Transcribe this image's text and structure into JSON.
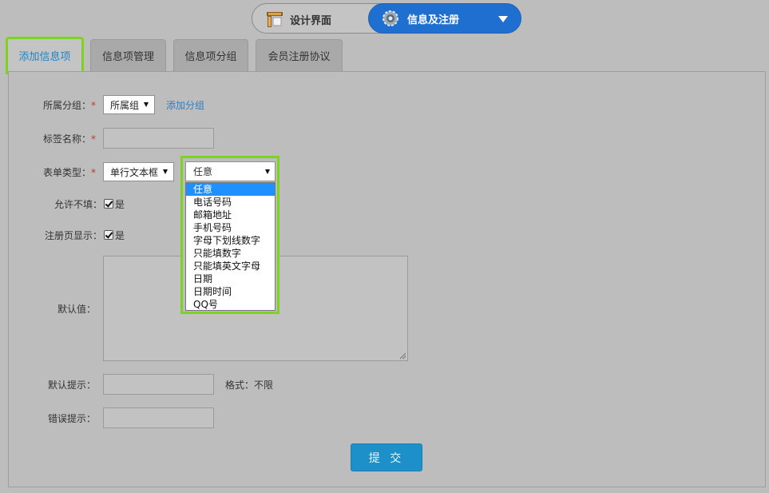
{
  "mode_switch": {
    "design_label": "设计界面",
    "info_label": "信息及注册"
  },
  "tabs": [
    {
      "label": "添加信息项",
      "active": true
    },
    {
      "label": "信息项管理",
      "active": false
    },
    {
      "label": "信息项分组",
      "active": false
    },
    {
      "label": "会员注册协议",
      "active": false
    }
  ],
  "form": {
    "group": {
      "label": "所属分组：",
      "required": "*",
      "value": "所属组",
      "add_link": "添加分组"
    },
    "tag_name": {
      "label": "标签名称：",
      "required": "*",
      "value": ""
    },
    "form_type": {
      "label": "表单类型：",
      "required": "*",
      "value": "单行文本框"
    },
    "allow_empty": {
      "label": "允许不填：",
      "checked": true,
      "text": "是"
    },
    "show_on_register": {
      "label": "注册页显示：",
      "checked": true,
      "text": "是"
    },
    "default_value": {
      "label": "默认值：",
      "value": ""
    },
    "default_hint": {
      "label": "默认提示：",
      "value": "",
      "format_note": "格式：不限"
    },
    "error_hint": {
      "label": "错误提示：",
      "value": ""
    },
    "submit_label": "提 交"
  },
  "format_dropdown": {
    "selected": "任意",
    "options": [
      "任意",
      "电话号码",
      "邮箱地址",
      "手机号码",
      "字母下划线数字",
      "只能填数字",
      "只能填英文字母",
      "日期",
      "日期时间",
      "QQ号"
    ],
    "highlighted_index": 0
  },
  "colors": {
    "accent_blue": "#1f6fd1",
    "highlight_green": "#7ed321",
    "link_blue": "#2f7fc0",
    "button_blue": "#1e90c9"
  }
}
